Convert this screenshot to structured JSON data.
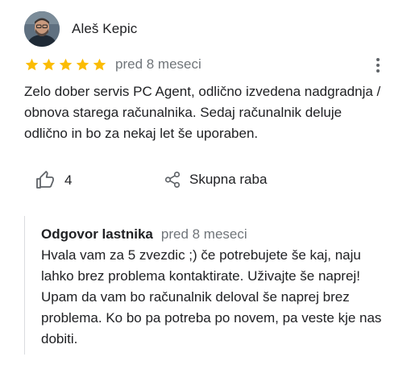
{
  "review": {
    "author": "Aleš Kepic",
    "stars": 5,
    "time": "pred 8 meseci",
    "text": "Zelo dober servis PC Agent, odlično izvedena nadgradnja / obnova starega računalnika. Sedaj računalnik deluje odlično in bo za nekaj let še uporaben.",
    "likes": "4",
    "share_label": "Skupna raba"
  },
  "owner_reply": {
    "title": "Odgovor lastnika",
    "time": "pred 8 meseci",
    "text": "Hvala vam za 5 zvezdic ;) če potrebujete še kaj, naju lahko brez problema kontaktirate. Uživajte še naprej! Upam da vam bo računalnik deloval še naprej brez problema. Ko bo pa potreba po novem, pa veste kje nas dobiti."
  },
  "colors": {
    "star": "#fbbc04",
    "secondary_text": "#70757a",
    "primary_text": "#202124",
    "divider": "#dadce0"
  },
  "icons": [
    "avatar-photo",
    "star-icon",
    "more-vert-icon",
    "thumb-up-icon",
    "share-icon"
  ]
}
